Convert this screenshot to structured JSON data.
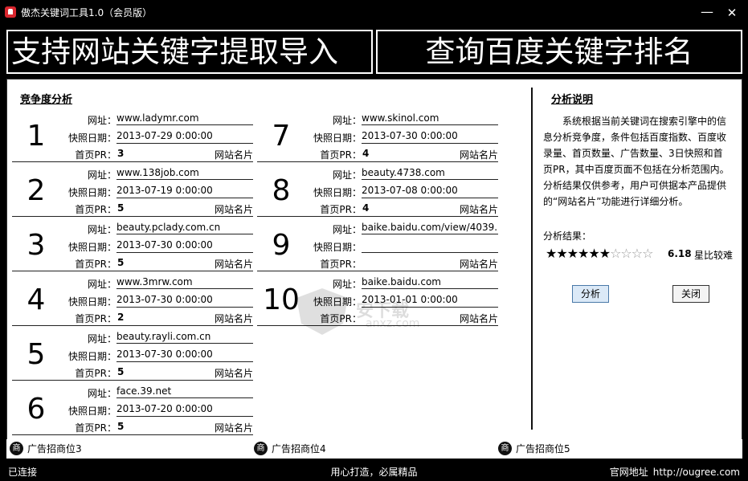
{
  "window": {
    "title": "傲杰关键词工具1.0（会员版）",
    "minimize_glyph": "—",
    "close_glyph": "✕"
  },
  "banners": {
    "left": "支持网站关键字提取导入",
    "right": "查询百度关键字排名"
  },
  "competition": {
    "title": "竞争度分析",
    "labels": {
      "url": "网址：",
      "snapshot": "快照日期：",
      "pr": "首页PR：",
      "card": "网站名片"
    },
    "items": [
      {
        "rank": "1",
        "url": "www.ladymr.com",
        "snapshot": "2013-07-29 0:00:00",
        "pr": "3"
      },
      {
        "rank": "2",
        "url": "www.138job.com",
        "snapshot": "2013-07-19 0:00:00",
        "pr": "5"
      },
      {
        "rank": "3",
        "url": "beauty.pclady.com.cn",
        "snapshot": "2013-07-30 0:00:00",
        "pr": "5"
      },
      {
        "rank": "4",
        "url": "www.3mrw.com",
        "snapshot": "2013-07-30 0:00:00",
        "pr": "2"
      },
      {
        "rank": "5",
        "url": "beauty.rayli.com.cn",
        "snapshot": "2013-07-30 0:00:00",
        "pr": "5"
      },
      {
        "rank": "6",
        "url": "face.39.net",
        "snapshot": "2013-07-20 0:00:00",
        "pr": "5"
      },
      {
        "rank": "7",
        "url": "www.skinol.com",
        "snapshot": "2013-07-30 0:00:00",
        "pr": "4"
      },
      {
        "rank": "8",
        "url": "beauty.4738.com",
        "snapshot": "2013-07-08 0:00:00",
        "pr": "4"
      },
      {
        "rank": "9",
        "url": "baike.baidu.com/view/4039.",
        "snapshot": "",
        "pr": ""
      },
      {
        "rank": "10",
        "url": "baike.baidu.com",
        "snapshot": "2013-01-01 0:00:00",
        "pr": ""
      }
    ]
  },
  "analysis": {
    "title": "分析说明",
    "description": "系统根据当前关键词在搜索引擎中的信息分析竞争度，条件包括百度指数、百度收录量、首页数量、广告数量、3日快照和首页PR，其中百度页面不包括在分析范围内。分析结果仅供参考，用户可供据本产品提供的“网站名片”功能进行详细分析。",
    "result_label": "分析结果：",
    "stars_filled": 6,
    "stars_total": 10,
    "score": "6.18",
    "score_text": "星比较难",
    "analyze_button": "分析",
    "close_button": "关闭"
  },
  "ads": [
    {
      "icon": "商",
      "label": "广告招商位3"
    },
    {
      "icon": "商",
      "label": "广告招商位4"
    },
    {
      "icon": "商",
      "label": "广告招商位5"
    }
  ],
  "status": {
    "left": "已连接",
    "center": "用心打造，必属精品",
    "site_label": "官网地址",
    "site_url": "http://ougree.com"
  },
  "watermark": {
    "text": "安下载",
    "sub": "anxz.com"
  }
}
